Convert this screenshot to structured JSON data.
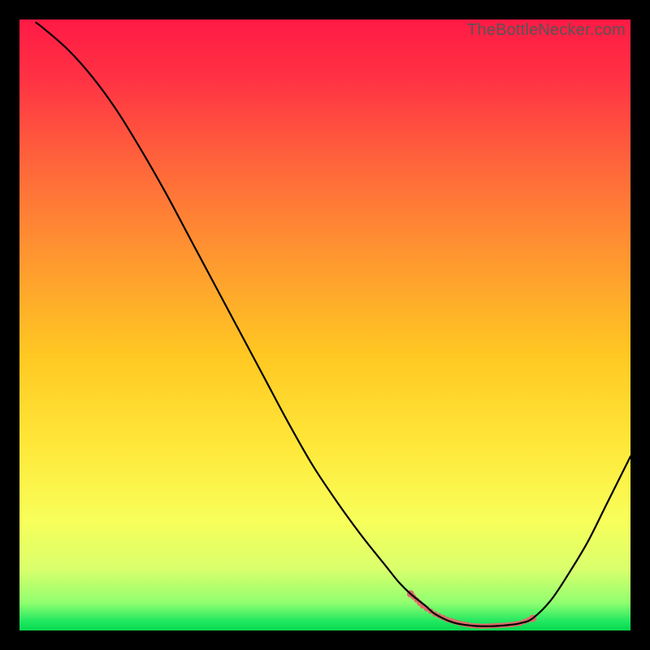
{
  "watermark": "TheBottleNecker.com",
  "chart_data": {
    "type": "line",
    "title": "",
    "xlabel": "",
    "ylabel": "",
    "xlim": [
      0,
      100
    ],
    "ylim": [
      0,
      100
    ],
    "grid": false,
    "series": [
      {
        "name": "bottleneck-curve",
        "x_pct": [
          2.7,
          4,
          8,
          12,
          16,
          20,
          24,
          28,
          32,
          36,
          40,
          44,
          48,
          52,
          56,
          60,
          62,
          64,
          66.5,
          68,
          71,
          74,
          77,
          80,
          82,
          84,
          87,
          90,
          93,
          96,
          98,
          100
        ],
        "y_pct": [
          99.5,
          98.5,
          95,
          90.5,
          85,
          78.5,
          71.5,
          64,
          56.5,
          49,
          41.5,
          34,
          27,
          21,
          15.5,
          10.5,
          8,
          6,
          4,
          2.7,
          1.3,
          0.8,
          0.7,
          0.9,
          1.2,
          2.0,
          5,
          9.5,
          14.5,
          20.5,
          24.5,
          28.5
        ]
      },
      {
        "name": "highlight-band",
        "x_pct": [
          64,
          66,
          68,
          70,
          72,
          74,
          76,
          78,
          80,
          82,
          84
        ],
        "y_pct": [
          6,
          4,
          2.7,
          1.8,
          1.2,
          0.8,
          0.7,
          0.8,
          0.9,
          1.2,
          2.0
        ]
      }
    ],
    "gradient_stops": [
      {
        "offset": 0.0,
        "color": "#ff1a45"
      },
      {
        "offset": 0.1,
        "color": "#ff3344"
      },
      {
        "offset": 0.25,
        "color": "#ff6a3a"
      },
      {
        "offset": 0.4,
        "color": "#ff9a2f"
      },
      {
        "offset": 0.55,
        "color": "#ffc822"
      },
      {
        "offset": 0.7,
        "color": "#ffe83a"
      },
      {
        "offset": 0.82,
        "color": "#f8ff5a"
      },
      {
        "offset": 0.9,
        "color": "#d9ff6c"
      },
      {
        "offset": 0.955,
        "color": "#90ff70"
      },
      {
        "offset": 0.985,
        "color": "#20e860"
      },
      {
        "offset": 1.0,
        "color": "#07d94f"
      }
    ]
  }
}
